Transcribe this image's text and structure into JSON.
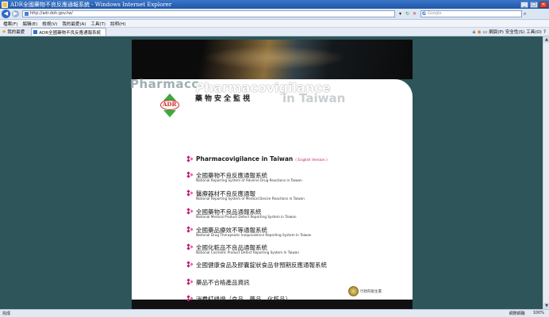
{
  "window": {
    "title": "ADR全國藥物不良反應通報系統 - Windows Internet Explorer"
  },
  "address_bar": {
    "url": "http://adr.doh.gov.tw/",
    "search_placeholder": "Google"
  },
  "menu": {
    "items": [
      "檔案(F)",
      "編輯(E)",
      "檢視(V)",
      "我的最愛(A)",
      "工具(T)",
      "說明(H)"
    ]
  },
  "tabbar": {
    "favorites_label": "我的最愛",
    "tab_title": "ADR全國藥物不良反應通報系統",
    "command_items": [
      "網頁(P)",
      "安全性(S)",
      "工具(O)"
    ]
  },
  "page": {
    "bg_word": "Pharmaco",
    "title": "Pharmacovigilance",
    "subtitle_cn": "藥物安全監視",
    "in_taiwan": "in Taiwan",
    "logo_text": "ADR",
    "items": [
      {
        "cn": "Pharmacovigilance in Taiwan",
        "tag": "( English Version )",
        "en": ""
      },
      {
        "cn": "全國藥物不良反應通報系統",
        "en": "National Reporting System of Adverse Drug Reactions in Taiwan"
      },
      {
        "cn": "醫療器材不良反應通報",
        "en": "National Reporting System of Medical Device Reactions in Taiwan"
      },
      {
        "cn": "全國藥物不良品通報系統",
        "en": "National Medical Product Defect Reporting System in Taiwan"
      },
      {
        "cn": "全國藥品療效不等通報系統",
        "en": "National Drug Therapeutic Inequivalence Reporting System In Taiwan"
      },
      {
        "cn": "全國化粧品不良品通報系統",
        "en": "National Cosmetic Product Defect Reporting System In Taiwan"
      },
      {
        "cn": "全國健康食品及膠囊錠狀食品非預期反應通報系統",
        "en": ""
      },
      {
        "cn": "藥品不合格產品資訊",
        "en": ""
      },
      {
        "cn": "消費紅綠燈（食品、藥品、化粧品）",
        "en": ""
      }
    ],
    "emblem_label": "行政院衛生署"
  },
  "statusbar": {
    "left": "完成",
    "zone": "網際網路",
    "zoom": "100%"
  },
  "colors": {
    "background": "#2e5559",
    "accent": "#c4126f",
    "titlebar": "#2b64b8"
  }
}
